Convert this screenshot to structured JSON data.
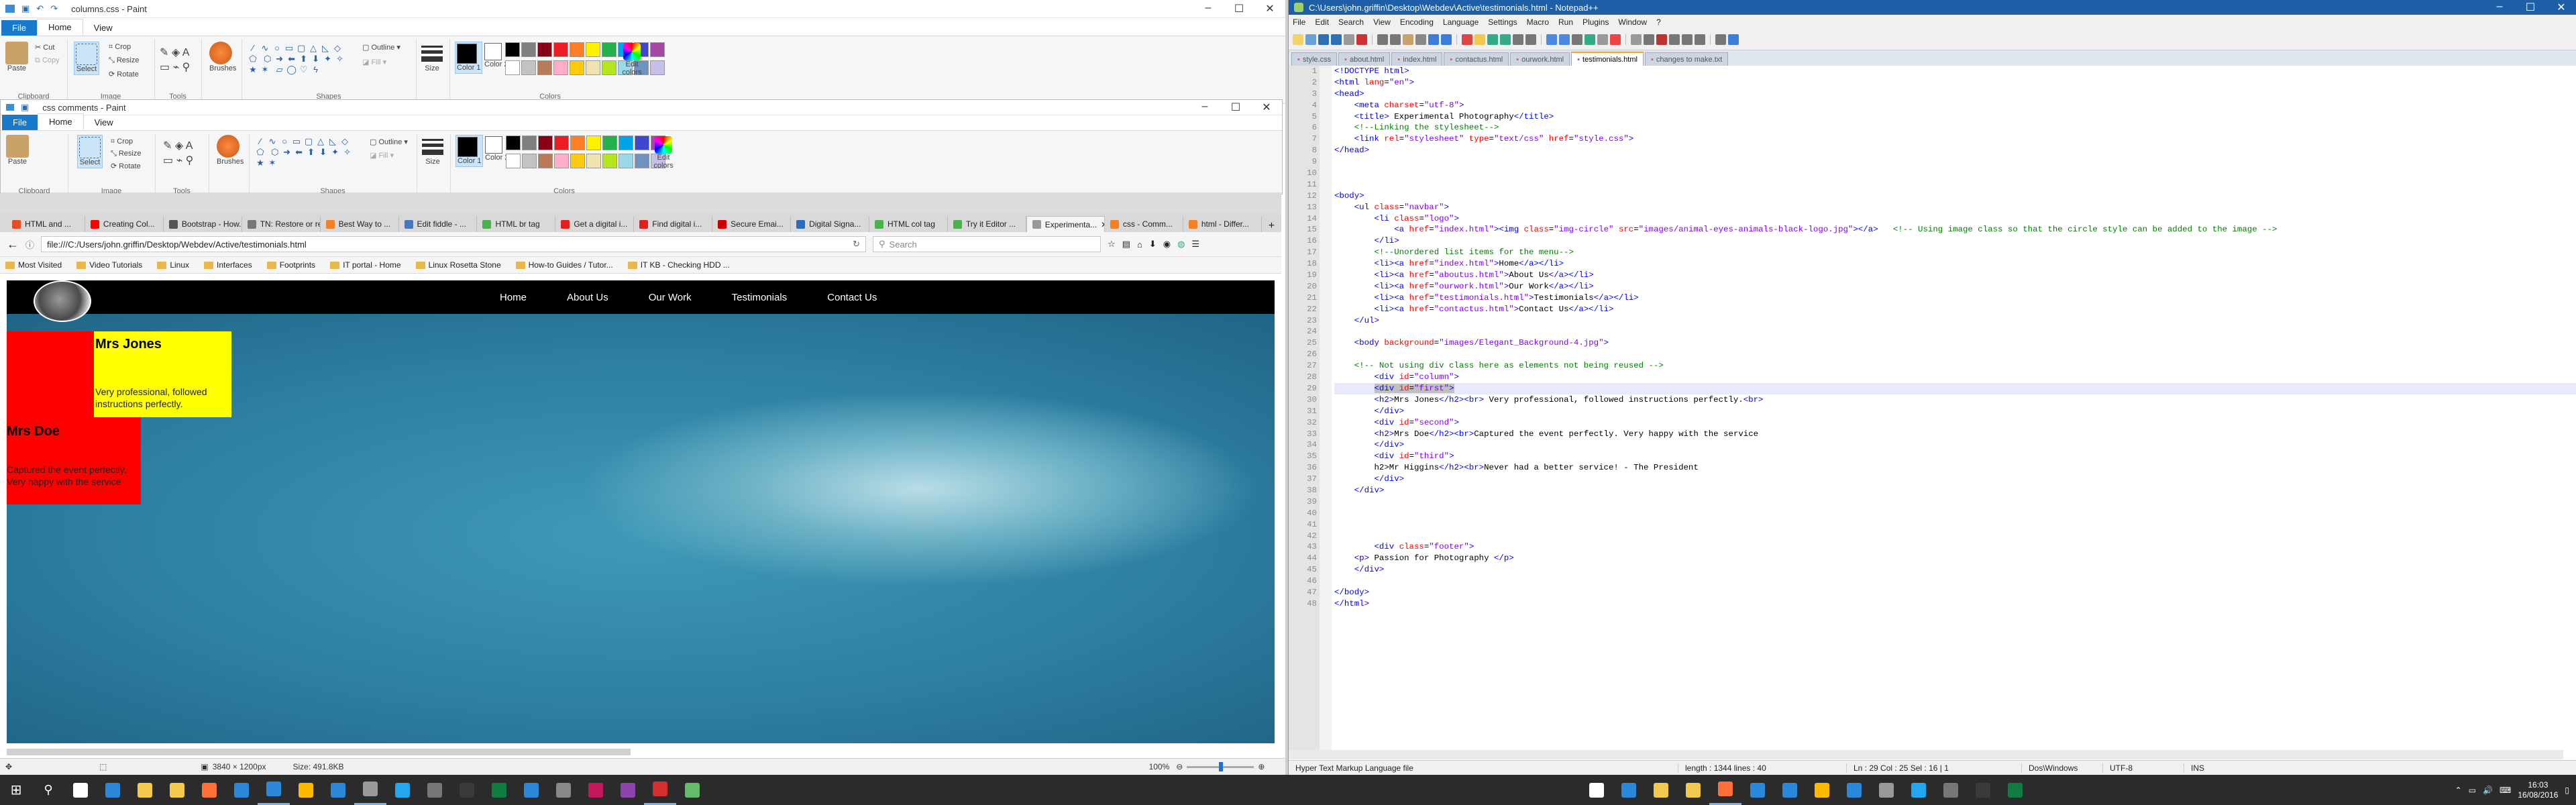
{
  "paint": {
    "title": "columns.css - Paint",
    "tabs": [
      "File",
      "Home",
      "View"
    ],
    "clipboard": {
      "paste": "Paste",
      "cut": "Cut",
      "copy": "Copy",
      "label": "Clipboard"
    },
    "image": {
      "select": "Select",
      "crop": "Crop",
      "resize": "Resize",
      "rotate": "Rotate",
      "label": "Image"
    },
    "tools": {
      "label": "Tools"
    },
    "brushes": "Brushes",
    "shapes": {
      "outline": "Outline",
      "fill": "Fill",
      "label": "Shapes"
    },
    "size": "Size",
    "color1": "Color 1",
    "color2": "Color 2",
    "colors_label": "Colors",
    "edit_colors": "Edit colors",
    "palette": [
      "#000000",
      "#7f7f7f",
      "#880015",
      "#ed1c24",
      "#ff7f27",
      "#fff200",
      "#22b14c",
      "#00a2e8",
      "#3f48cc",
      "#a349a4",
      "#ffffff",
      "#c3c3c3",
      "#b97a57",
      "#ffaec9",
      "#ffc90e",
      "#efe4b0",
      "#b5e61d",
      "#99d9ea",
      "#7092be",
      "#c8bfe7"
    ],
    "status": {
      "dims": "3840 × 1200px",
      "size": "Size: 491.8KB",
      "zoom": "100%"
    }
  },
  "paint2": {
    "title": "css comments - Paint"
  },
  "browser": {
    "tabs": [
      {
        "label": "HTML and ...",
        "color": "#e44d26"
      },
      {
        "label": "Creating Col...",
        "color": "#ff0000"
      },
      {
        "label": "Bootstrap - How...",
        "color": "#555555"
      },
      {
        "label": "TN: Restore or re...",
        "color": "#777777"
      },
      {
        "label": "Best Way to ...",
        "color": "#f48024"
      },
      {
        "label": "Edit fiddle - ...",
        "color": "#4679bd"
      },
      {
        "label": "HTML br tag",
        "color": "#4caf50"
      },
      {
        "label": "Get a digital i...",
        "color": "#e02020"
      },
      {
        "label": "Find digital i...",
        "color": "#e02020"
      },
      {
        "label": "Secure Emai...",
        "color": "#cc0000"
      },
      {
        "label": "Digital Signa...",
        "color": "#2a6ebb"
      },
      {
        "label": "HTML col tag",
        "color": "#4caf50"
      },
      {
        "label": "Try it Editor ...",
        "color": "#4caf50"
      },
      {
        "label": "Experimenta...",
        "color": "#999999"
      },
      {
        "label": "css - Comm...",
        "color": "#f48024"
      },
      {
        "label": "html - Differ...",
        "color": "#f48024"
      }
    ],
    "url": "file:///C:/Users/john.griffin/Desktop/Webdev/Active/testimonials.html",
    "search_placeholder": "Search",
    "bookmarks": [
      "Most Visited",
      "Video Tutorials",
      "Linux",
      "Interfaces",
      "Footprints",
      "IT portal - Home",
      "Linux Rosetta Stone",
      "How-to Guides / Tutor...",
      "IT KB - Checking HDD ..."
    ],
    "site": {
      "nav": [
        "Home",
        "About Us",
        "Our Work",
        "Testimonials",
        "Contact Us"
      ],
      "first": {
        "name": "Mrs Jones",
        "text": "Very professional, followed instructions perfectly."
      },
      "second": {
        "name": "Mrs Doe",
        "text": "Captured the event perfectly. Very happy with the service"
      }
    }
  },
  "npp": {
    "title": "C:\\Users\\john.griffin\\Desktop\\Webdev\\Active\\testimonials.html - Notepad++",
    "menu": [
      "File",
      "Edit",
      "Search",
      "View",
      "Encoding",
      "Language",
      "Settings",
      "Macro",
      "Run",
      "Plugins",
      "Window",
      "?"
    ],
    "tabs": [
      "style.css",
      "about.html",
      "index.html",
      "contactus.html",
      "ourwork.html",
      "testimonials.html",
      "changes to make.txt"
    ],
    "active_tab": "testimonials.html",
    "status": {
      "type": "Hyper Text Markup Language file",
      "length": "length : 1344    lines : 40",
      "pos": "Ln : 29    Col : 25    Sel : 16 | 1",
      "eol": "Dos\\Windows",
      "enc": "UTF-8",
      "ins": "INS"
    },
    "lines": [
      {
        "n": 1,
        "html": "<span class='tag'>&lt;!DOCTYPE html&gt;</span>"
      },
      {
        "n": 2,
        "html": "<span class='tag'>&lt;html</span> <span class='attr'>lang</span>=<span class='val'>\"en\"</span><span class='tag'>&gt;</span>"
      },
      {
        "n": 3,
        "html": "<span class='tag'>&lt;head&gt;</span>"
      },
      {
        "n": 4,
        "html": "    <span class='tag'>&lt;meta</span> <span class='attr'>charset</span>=<span class='val'>\"utf-8\"</span><span class='tag'>&gt;</span>"
      },
      {
        "n": 5,
        "html": "    <span class='tag'>&lt;title&gt;</span> Experimental Photography<span class='tag'>&lt;/title&gt;</span>"
      },
      {
        "n": 6,
        "html": "    <span class='cmt'>&lt;!--Linking the stylesheet--&gt;</span>"
      },
      {
        "n": 7,
        "html": "    <span class='tag'>&lt;link</span> <span class='attr'>rel</span>=<span class='val'>\"stylesheet\"</span> <span class='attr'>type</span>=<span class='val'>\"text/css\"</span> <span class='attr'>href</span>=<span class='val'>\"style.css\"</span><span class='tag'>&gt;</span>"
      },
      {
        "n": 8,
        "html": "<span class='tag'>&lt;/head&gt;</span>"
      },
      {
        "n": 9,
        "html": ""
      },
      {
        "n": 10,
        "html": ""
      },
      {
        "n": 11,
        "html": ""
      },
      {
        "n": 12,
        "html": "<span class='tag'>&lt;body&gt;</span>"
      },
      {
        "n": 13,
        "html": "    <span class='tag'>&lt;ul</span> <span class='attr'>class</span>=<span class='val'>\"navbar\"</span><span class='tag'>&gt;</span>"
      },
      {
        "n": 14,
        "html": "        <span class='tag'>&lt;li</span> <span class='attr'>class</span>=<span class='val'>\"logo\"</span><span class='tag'>&gt;</span>"
      },
      {
        "n": 15,
        "html": "            <span class='tag'>&lt;a</span> <span class='attr'>href</span>=<span class='val'>\"index.html\"</span><span class='tag'>&gt;&lt;img</span> <span class='attr'>class</span>=<span class='val'>\"img-circle\"</span> <span class='attr'>src</span>=<span class='val'>\"images/animal-eyes-animals-black-logo.jpg\"</span><span class='tag'>&gt;&lt;/a&gt;</span>   <span class='cmt'>&lt;!-- Using image class so that the circle style can be added to the image --&gt;</span>"
      },
      {
        "n": 16,
        "html": "        <span class='tag'>&lt;/li&gt;</span>"
      },
      {
        "n": 17,
        "html": "        <span class='cmt'>&lt;!--Unordered list items for the menu--&gt;</span>"
      },
      {
        "n": 18,
        "html": "        <span class='tag'>&lt;li&gt;&lt;a</span> <span class='attr'>href</span>=<span class='val'>\"index.html\"</span><span class='tag'>&gt;</span>Home<span class='tag'>&lt;/a&gt;&lt;/li&gt;</span>"
      },
      {
        "n": 19,
        "html": "        <span class='tag'>&lt;li&gt;&lt;a</span> <span class='attr'>href</span>=<span class='val'>\"aboutus.html\"</span><span class='tag'>&gt;</span>About Us<span class='tag'>&lt;/a&gt;&lt;/li&gt;</span>"
      },
      {
        "n": 20,
        "html": "        <span class='tag'>&lt;li&gt;&lt;a</span> <span class='attr'>href</span>=<span class='val'>\"ourwork.html\"</span><span class='tag'>&gt;</span>Our Work<span class='tag'>&lt;/a&gt;&lt;/li&gt;</span>"
      },
      {
        "n": 21,
        "html": "        <span class='tag'>&lt;li&gt;&lt;a</span> <span class='attr'>href</span>=<span class='val'>\"testimonials.html\"</span><span class='tag'>&gt;</span>Testimonials<span class='tag'>&lt;/a&gt;&lt;/li&gt;</span>"
      },
      {
        "n": 22,
        "html": "        <span class='tag'>&lt;li&gt;&lt;a</span> <span class='attr'>href</span>=<span class='val'>\"contactus.html\"</span><span class='tag'>&gt;</span>Contact Us<span class='tag'>&lt;/a&gt;&lt;/li&gt;</span>"
      },
      {
        "n": 23,
        "html": "    <span class='tag'>&lt;/ul&gt;</span>"
      },
      {
        "n": 24,
        "html": ""
      },
      {
        "n": 25,
        "html": "    <span class='tag'>&lt;body</span> <span class='attr'>background</span>=<span class='val'>\"images/Elegant_Background-4.jpg\"</span><span class='tag'>&gt;</span>"
      },
      {
        "n": 26,
        "html": ""
      },
      {
        "n": 27,
        "html": "    <span class='cmt'>&lt;!-- Not using div class here as elements not being reused --&gt;</span>"
      },
      {
        "n": 28,
        "html": "        <span class='tag'>&lt;div</span> <span class='attr'>id</span>=<span class='val'>\"column\"</span><span class='tag'>&gt;</span>"
      },
      {
        "n": 29,
        "html": "        <span class='tag' style='background:#c0c0c0'>&lt;div</span><span style='background:#c0c0c0'> <span class='attr'>id</span>=<span class='val'>\"first\"</span><span class='tag'>&gt;</span></span>",
        "cur": true
      },
      {
        "n": 30,
        "html": "        <span class='tag'>&lt;h2&gt;</span>Mrs Jones<span class='tag'>&lt;/h2&gt;&lt;br&gt;</span> Very professional, followed instructions perfectly.<span class='tag'>&lt;br&gt;</span>"
      },
      {
        "n": 31,
        "html": "        <span class='tag'>&lt;/div&gt;</span>"
      },
      {
        "n": 32,
        "html": "        <span class='tag'>&lt;div</span> <span class='attr'>id</span>=<span class='val'>\"second\"</span><span class='tag'>&gt;</span>"
      },
      {
        "n": 33,
        "html": "        <span class='tag'>&lt;h2&gt;</span>Mrs Doe<span class='tag'>&lt;/h2&gt;&lt;br&gt;</span>Captured the event perfectly. Very happy with the service"
      },
      {
        "n": 34,
        "html": "        <span class='tag'>&lt;/div&gt;</span>"
      },
      {
        "n": 35,
        "html": "        <span class='tag'>&lt;div</span> <span class='attr'>id</span>=<span class='val'>\"third\"</span><span class='tag'>&gt;</span>"
      },
      {
        "n": 36,
        "html": "        h2&gt;Mr Higgins<span class='tag'>&lt;/h2&gt;&lt;br&gt;</span>Never had a better service! - The President"
      },
      {
        "n": 37,
        "html": "        <span class='tag'>&lt;/div&gt;</span>"
      },
      {
        "n": 38,
        "html": "    <span class='tag'>&lt;/div&gt;</span>"
      },
      {
        "n": 39,
        "html": ""
      },
      {
        "n": 40,
        "html": ""
      },
      {
        "n": 41,
        "html": ""
      },
      {
        "n": 42,
        "html": ""
      },
      {
        "n": 43,
        "html": "        <span class='tag'>&lt;div</span> <span class='attr'>class</span>=<span class='val'>\"footer\"</span><span class='tag'>&gt;</span>"
      },
      {
        "n": 44,
        "html": "    <span class='tag'>&lt;p&gt;</span> Passion for Photography <span class='tag'>&lt;/p&gt;</span>"
      },
      {
        "n": 45,
        "html": "    <span class='tag'>&lt;/div&gt;</span>"
      },
      {
        "n": 46,
        "html": ""
      },
      {
        "n": 47,
        "html": "<span class='tag'>&lt;/body&gt;</span>"
      },
      {
        "n": 48,
        "html": "<span class='tag'>&lt;/html&gt;</span>"
      }
    ]
  },
  "taskbar": {
    "time": "16:03",
    "date": "16/08/2016",
    "apps": [
      "#ffffff",
      "#2b88d8",
      "#f2c94c",
      "#f2c94c",
      "#ff7139",
      "#2b88d8",
      "#2b88d8",
      "#ffb900",
      "#2b88d8",
      "#999999",
      "#22a7f0",
      "#777777",
      "#3a3a3a",
      "#107c41",
      "#2b88d8",
      "#888888",
      "#c2185b",
      "#8e44ad",
      "#d32f2f",
      "#66bb6a"
    ]
  }
}
